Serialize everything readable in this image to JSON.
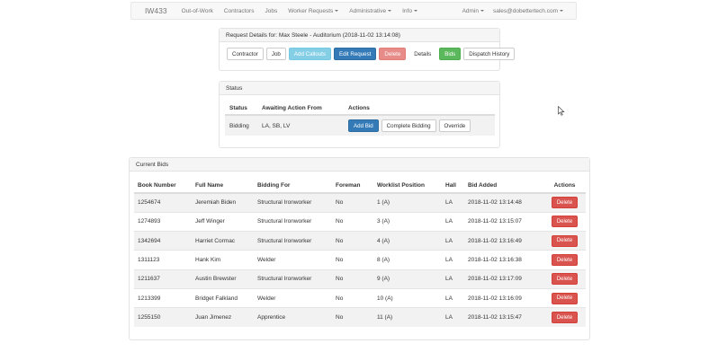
{
  "nav": {
    "brand": "IW433",
    "items": [
      "Out-of-Work",
      "Contractors",
      "Jobs"
    ],
    "dropdowns": [
      "Worker Requests",
      "Administrative",
      "Info"
    ],
    "right": [
      "Admin",
      "sales@dobettertech.com"
    ]
  },
  "request": {
    "heading": "Request Details for: Max Steele - Auditorium (2018-11-02 13:14:08)",
    "buttons": {
      "contractor": "Contractor",
      "job": "Job",
      "add_callouts": "Add Callouts",
      "edit_request": "Edit Request",
      "delete": "Delete",
      "details": "Details",
      "bids": "Bids",
      "dispatch_history": "Dispatch History"
    }
  },
  "status": {
    "heading": "Status",
    "columns": [
      "Status",
      "Awaiting Action From",
      "Actions"
    ],
    "row": {
      "status": "Bidding",
      "awaiting": "LA, SB, LV"
    },
    "actions": {
      "add_bid": "Add Bid",
      "complete_bidding": "Complete Bidding",
      "override": "Override"
    }
  },
  "bids": {
    "heading": "Current Bids",
    "columns": [
      "Book Number",
      "Full Name",
      "Bidding For",
      "Foreman",
      "Worklist Position",
      "Hall",
      "Bid Added",
      "Actions"
    ],
    "delete_label": "Delete",
    "rows": [
      {
        "book": "1254674",
        "name": "Jeremiah Biden",
        "for": "Structural Ironworker",
        "foreman": "No",
        "pos": "1 (A)",
        "hall": "LA",
        "added": "2018-11-02 13:14:48"
      },
      {
        "book": "1274893",
        "name": "Jeff Winger",
        "for": "Structural Ironworker",
        "foreman": "No",
        "pos": "3 (A)",
        "hall": "LA",
        "added": "2018-11-02 13:15:07"
      },
      {
        "book": "1342694",
        "name": "Harriet Cormac",
        "for": "Structural Ironworker",
        "foreman": "No",
        "pos": "4 (A)",
        "hall": "LA",
        "added": "2018-11-02 13:16:49"
      },
      {
        "book": "1311123",
        "name": "Hank Kim",
        "for": "Welder",
        "foreman": "No",
        "pos": "8 (A)",
        "hall": "LA",
        "added": "2018-11-02 13:16:38"
      },
      {
        "book": "1211637",
        "name": "Austin Brewster",
        "for": "Structural Ironworker",
        "foreman": "No",
        "pos": "9 (A)",
        "hall": "LA",
        "added": "2018-11-02 13:17:09"
      },
      {
        "book": "1213399",
        "name": "Bridget Falkland",
        "for": "Welder",
        "foreman": "No",
        "pos": "10 (A)",
        "hall": "LA",
        "added": "2018-11-02 13:16:09"
      },
      {
        "book": "1255150",
        "name": "Juan Jimenez",
        "for": "Apprentice",
        "foreman": "No",
        "pos": "11 (A)",
        "hall": "LA",
        "added": "2018-11-02 13:15:47"
      }
    ]
  }
}
